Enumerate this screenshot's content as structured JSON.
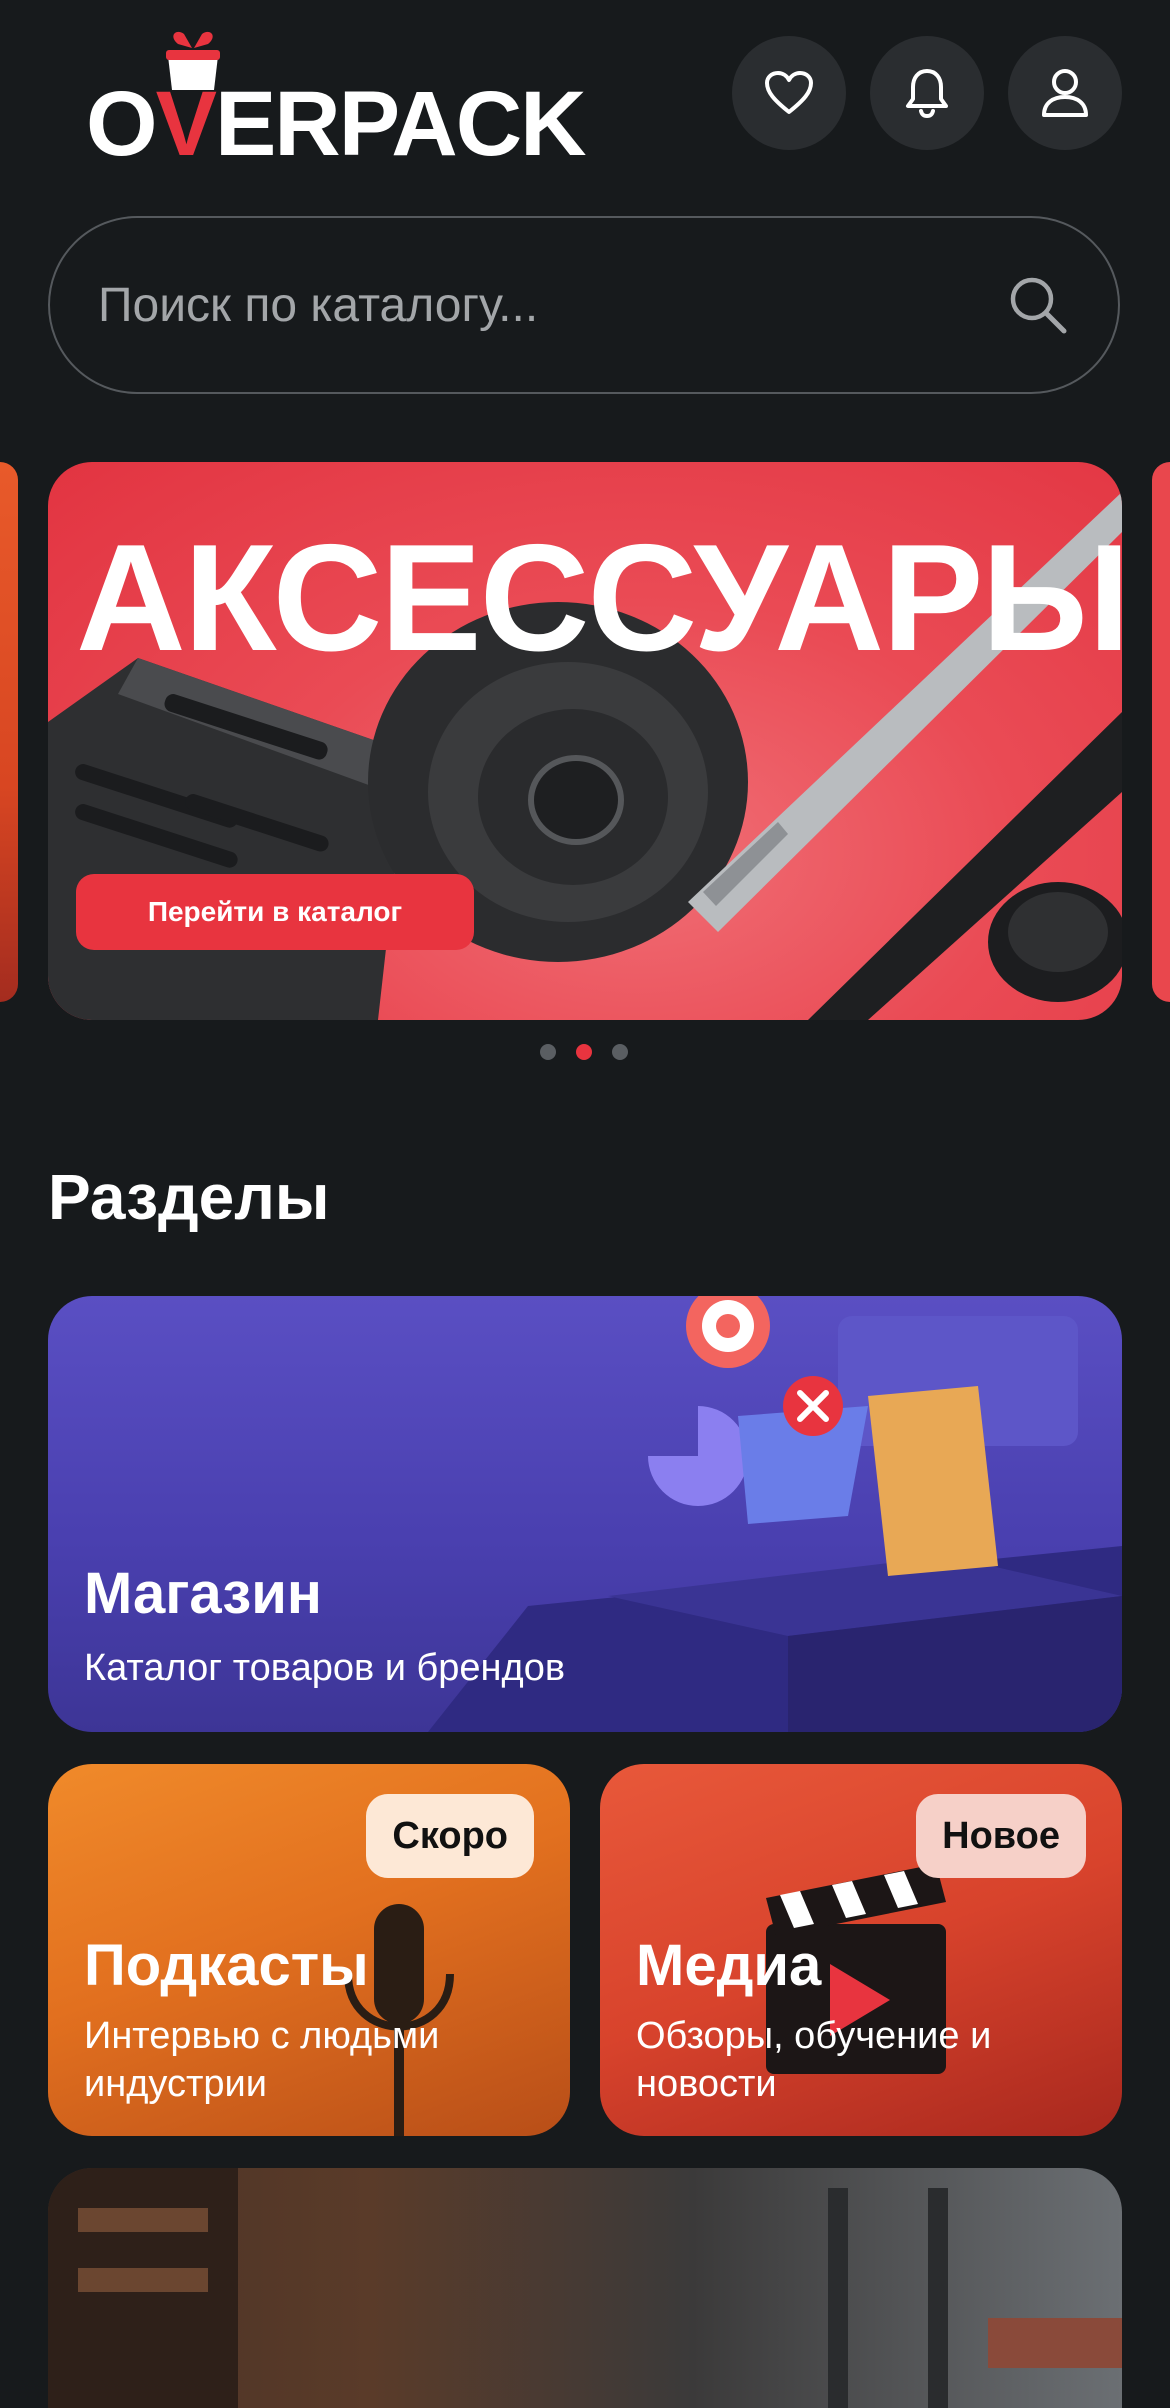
{
  "header": {
    "logo_text_pre": "O",
    "logo_text_v": "V",
    "logo_text_post": "ERPACK",
    "icons": [
      "heart-icon",
      "bell-icon",
      "user-icon"
    ]
  },
  "search": {
    "placeholder": "Поиск по каталогу..."
  },
  "banner": {
    "title": "АКСЕССУАРЫ",
    "button": "Перейти в каталог",
    "dots": 3,
    "active_dot": 1
  },
  "sections": {
    "title": "Разделы",
    "shop": {
      "title": "Магазин",
      "subtitle": "Каталог товаров и брендов"
    },
    "podcasts": {
      "title": "Подкасты",
      "subtitle": "Интервью с людьми индустрии",
      "badge": "Скоро"
    },
    "media": {
      "title": "Медиа",
      "subtitle": "Обзоры, обучение  и новости",
      "badge": "Новое"
    }
  },
  "colors": {
    "accent": "#e8343f",
    "background": "#171a1c",
    "button_bg": "#2a2d30"
  }
}
